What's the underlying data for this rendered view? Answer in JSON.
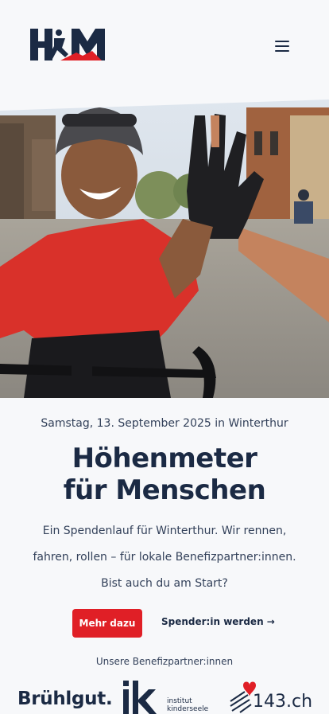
{
  "header": {
    "logo_text": "HFM",
    "menu_icon": "hamburger-menu-icon"
  },
  "hero": {
    "image_subject": "cyclist-high-five-photo"
  },
  "event": {
    "date": "Samstag, 13. September 2025 in Winterthur",
    "title_line1": "Höhenmeter",
    "title_line2": "für Menschen",
    "description": "Ein Spendenlauf für Winterthur. Wir rennen, fahren, rollen – für lokale Benefizpartner:innen. Bist auch du am Start?",
    "primary_cta": "Mehr dazu",
    "secondary_cta": "Spender:in werden →"
  },
  "partners": {
    "label": "Unsere Benefizpartner:innen",
    "items": [
      {
        "name": "Brühlgut."
      },
      {
        "name_top": "iks",
        "name_line1": "institut",
        "name_line2": "kinderseele"
      },
      {
        "name": "143.ch"
      }
    ]
  },
  "colors": {
    "accent": "#e01f26",
    "navy": "#1b2a44",
    "background": "#f7f8fa"
  }
}
